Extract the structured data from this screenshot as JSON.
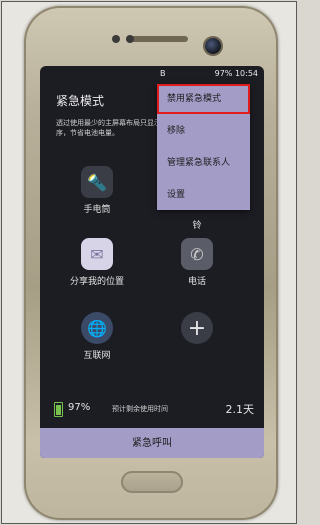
{
  "status_bar": {
    "left_icons": "B",
    "battery_text": "97%",
    "time": "10:54"
  },
  "page": {
    "title": "紧急模式",
    "description": "透过使用最少的主屏幕布局只显示必要的应用程序，节省电池电量。"
  },
  "menu": {
    "items": [
      {
        "label": "禁用紧急模式",
        "highlighted": true
      },
      {
        "label": "移除"
      },
      {
        "label": "管理紧急联系人"
      },
      {
        "label": "设置"
      }
    ]
  },
  "apps": [
    {
      "label": "手电筒",
      "icon": "flashlight-icon",
      "glyph": "🔦"
    },
    {
      "label": "铃",
      "icon": "bell-icon",
      "glyph": ""
    },
    {
      "label": "分享我的位置",
      "icon": "share-location-icon",
      "glyph": "✉"
    },
    {
      "label": "电话",
      "icon": "phone-icon",
      "glyph": "✆"
    },
    {
      "label": "互联网",
      "icon": "globe-icon",
      "glyph": "🌐"
    },
    {
      "label": "",
      "icon": "add-icon",
      "glyph": "+"
    }
  ],
  "battery": {
    "percent": "97%",
    "estimate_label": "预计剩余使用时间",
    "days": "2.1天"
  },
  "call_button": "紧急呼叫",
  "colors": {
    "accent": "#a39cc6",
    "highlight_border": "#e01c1c",
    "battery": "#77c14d"
  }
}
